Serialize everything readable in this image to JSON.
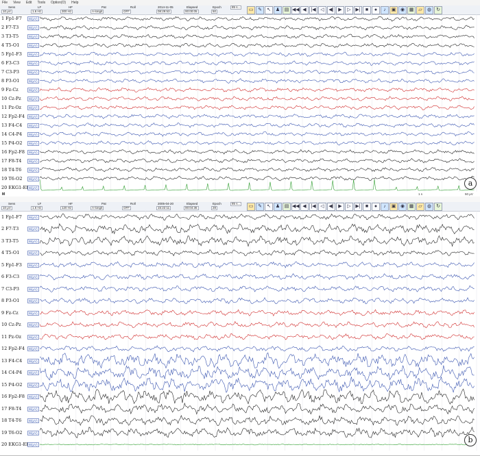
{
  "menu": [
    "File",
    "View",
    "Edit",
    "Tools",
    "Option(O)",
    "Help"
  ],
  "panels": [
    {
      "id": "a",
      "badge": "a",
      "toolbar": {
        "sens_label": "Sens",
        "sens_value": "10 μV",
        "lf_label": "LF",
        "lf_value": "1.6 Hz",
        "hf_label": "HF",
        "hf_value": "300 Hz",
        "pat_label": "Pat",
        "pat_value": "A-longit",
        "roll_label": "Roll",
        "roll_value": "OFF",
        "date_value": "2014-11-05",
        "time_value": "08:29:53",
        "elapsed_label": "Elapsed",
        "elapsed_value": "00:00:05",
        "epoch_label": "Epoch",
        "epoch_value": "50",
        "speed_value": "85 s..."
      },
      "bottom_left": "M",
      "marker": "1 s",
      "scale": "50 μV",
      "ecg_style": "spiky"
    },
    {
      "id": "b",
      "badge": "b",
      "toolbar": {
        "sens_label": "Sens",
        "sens_value": "10 μV",
        "lf_label": "LF",
        "lf_value": "1.6 Hz",
        "hf_label": "HF",
        "hf_value": "120 Hz",
        "pat_label": "Pat",
        "pat_value": "A-longit",
        "roll_label": "Roll",
        "roll_value": "OFF",
        "date_value": "2005-04-20",
        "time_value": "15:22:11",
        "elapsed_label": "Elapsed",
        "elapsed_value": "00:04:36",
        "epoch_label": "Epoch",
        "epoch_value": "28",
        "speed_value": "85 s..."
      },
      "bottom_left": "",
      "marker": "",
      "scale": "",
      "ecg_style": "flat"
    }
  ],
  "channels": [
    {
      "label": "1 Fp1-F7",
      "color": "#222222"
    },
    {
      "label": "2 F7-T3",
      "color": "#222222"
    },
    {
      "label": "3 T3-T5",
      "color": "#222222"
    },
    {
      "label": "4 T5-O1",
      "color": "#222222"
    },
    {
      "label": "5 Fp1-F3",
      "color": "#3a55b0"
    },
    {
      "label": "6 F3-C3",
      "color": "#3a55b0"
    },
    {
      "label": "7 C3-P3",
      "color": "#3a55b0"
    },
    {
      "label": "8 P3-O1",
      "color": "#3a55b0"
    },
    {
      "label": "9 Fz-Cz",
      "color": "#d02a2a"
    },
    {
      "label": "10 Cz-Pz",
      "color": "#d02a2a"
    },
    {
      "label": "11 Pz-Oz",
      "color": "#d02a2a"
    },
    {
      "label": "12 Fp2-F4",
      "color": "#3a55b0"
    },
    {
      "label": "13 F4-C4",
      "color": "#3a55b0"
    },
    {
      "label": "14 C4-P4",
      "color": "#3a55b0"
    },
    {
      "label": "15 P4-O2",
      "color": "#3a55b0"
    },
    {
      "label": "16 Fp2-F8",
      "color": "#222222"
    },
    {
      "label": "17 F8-T4",
      "color": "#222222"
    },
    {
      "label": "18 T4-T6",
      "color": "#222222"
    },
    {
      "label": "19 T6-O2",
      "color": "#222222"
    },
    {
      "label": "20 EKG1-EKG2",
      "color": "#2f9e2f"
    }
  ],
  "ref_tag": "Bi(μV)",
  "icons": [
    "ruler-icon",
    "pen-icon",
    "cursor-icon",
    "person-icon",
    "chart-icon",
    "rewind-icon",
    "back-icon",
    "first-icon",
    "prev-icon",
    "play-back-icon",
    "play-icon",
    "next-icon",
    "last-icon",
    "stop-icon",
    "record-icon",
    "note-icon",
    "book-icon",
    "camera-icon",
    "film-icon",
    "folder-icon",
    "globe-icon",
    "refresh-icon"
  ]
}
